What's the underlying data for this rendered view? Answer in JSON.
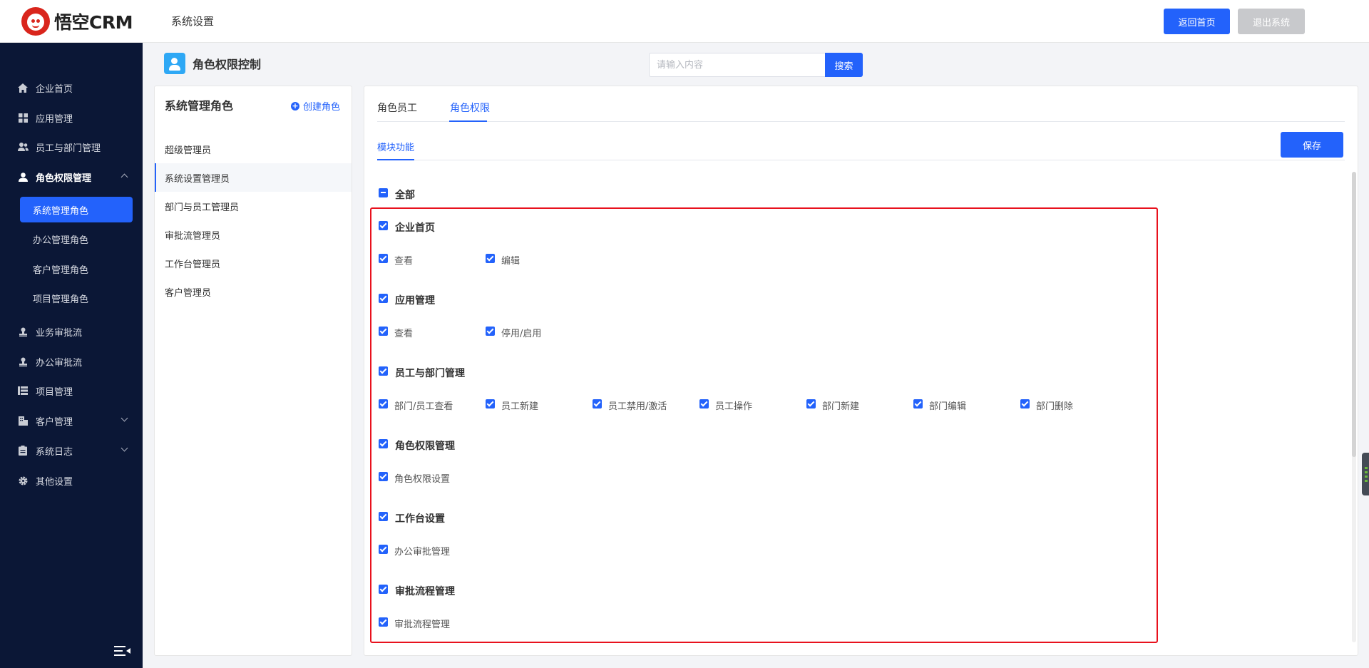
{
  "header": {
    "logo_text": "悟空CRM",
    "title": "系统设置",
    "home_button": "返回首页",
    "exit_button": "退出系统"
  },
  "sidebar": {
    "items": [
      {
        "label": "企业首页",
        "icon": "home-icon"
      },
      {
        "label": "应用管理",
        "icon": "grid-icon"
      },
      {
        "label": "员工与部门管理",
        "icon": "users-icon"
      },
      {
        "label": "角色权限管理",
        "icon": "user-icon"
      },
      {
        "label": "业务审批流",
        "icon": "stamp-icon"
      },
      {
        "label": "办公审批流",
        "icon": "stamp-icon"
      },
      {
        "label": "项目管理",
        "icon": "list-icon"
      },
      {
        "label": "客户管理",
        "icon": "building-icon"
      },
      {
        "label": "系统日志",
        "icon": "clipboard-icon"
      },
      {
        "label": "其他设置",
        "icon": "gear-icon"
      }
    ],
    "sub_items": [
      "系统管理角色",
      "办公管理角色",
      "客户管理角色",
      "项目管理角色"
    ]
  },
  "page": {
    "title": "角色权限控制",
    "search_placeholder": "请输入内容",
    "search_button": "搜索"
  },
  "roles": {
    "title": "系统管理角色",
    "create_label": "创建角色",
    "items": [
      "超级管理员",
      "系统设置管理员",
      "部门与员工管理员",
      "审批流管理员",
      "工作台管理员",
      "客户管理员"
    ],
    "active_index": 1
  },
  "permissions": {
    "tabs": [
      "角色员工",
      "角色权限"
    ],
    "active_tab": 1,
    "subtab": "模块功能",
    "save_button": "保存",
    "all_label": "全部",
    "groups": [
      {
        "name": "企业首页",
        "items": [
          "查看",
          "编辑"
        ]
      },
      {
        "name": "应用管理",
        "items": [
          "查看",
          "停用/启用"
        ]
      },
      {
        "name": "员工与部门管理",
        "items": [
          "部门/员工查看",
          "员工新建",
          "员工禁用/激活",
          "员工操作",
          "部门新建",
          "部门编辑",
          "部门删除"
        ]
      },
      {
        "name": "角色权限管理",
        "items": [
          "角色权限设置"
        ]
      },
      {
        "name": "工作台设置",
        "items": [
          "办公审批管理"
        ]
      },
      {
        "name": "审批流程管理",
        "items": [
          "审批流程管理"
        ]
      }
    ]
  },
  "colors": {
    "accent": "#2362fb",
    "sidebar_bg": "#0b1736",
    "highlight": "#e8111d"
  }
}
